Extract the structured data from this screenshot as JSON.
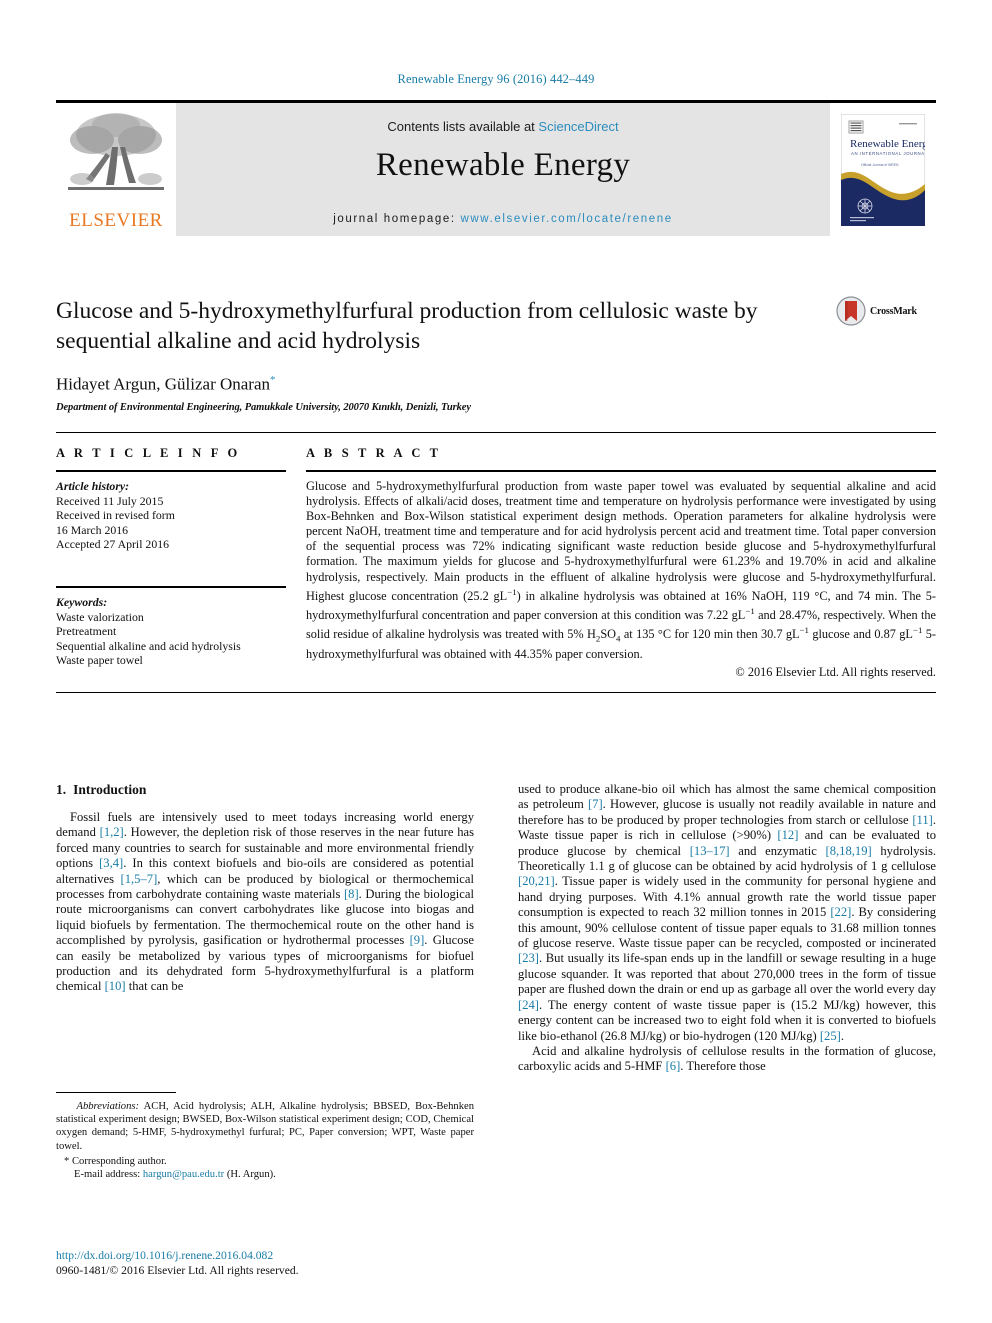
{
  "running_head": "Renewable Energy 96 (2016) 442–449",
  "banner": {
    "publisher_name": "ELSEVIER",
    "contents_prefix": "Contents lists available at ",
    "contents_link": "ScienceDirect",
    "journal_title": "Renewable Energy",
    "homepage_prefix": "journal homepage: ",
    "homepage_url": "www.elsevier.com/locate/renene",
    "cover_title": "Renewable Energy",
    "cover_subtitle": "AN INTERNATIONAL JOURNAL",
    "cover_line3": "Official Journal of WREN – Werner Heilingbrunner"
  },
  "article": {
    "title": "Glucose and 5-hydroxymethylfurfural production from cellulosic waste by sequential alkaline and acid hydrolysis",
    "authors": "Hidayet Argun, Gülizar Onaran",
    "author_marker": "*",
    "affiliation": "Department of Environmental Engineering, Pamukkale University, 20070 Kınıklı, Denizli, Turkey",
    "crossmark_label": "CrossMark"
  },
  "info": {
    "heading": "A R T I C L E   I N F O",
    "history_label": "Article history:",
    "history_lines": [
      "Received 11 July 2015",
      "Received in revised form",
      "16 March 2016",
      "Accepted 27 April 2016"
    ],
    "keywords_label": "Keywords:",
    "keywords": [
      "Waste valorization",
      "Pretreatment",
      "Sequential alkaline and acid hydrolysis",
      "Waste paper towel"
    ]
  },
  "abstract": {
    "heading": "A B S T R A C T",
    "text": "Glucose and 5-hydroxymethylfurfural production from waste paper towel was evaluated by sequential alkaline and acid hydrolysis. Effects of alkali/acid doses, treatment time and temperature on hydrolysis performance were investigated by using Box-Behnken and Box-Wilson statistical experiment design methods. Operation parameters for alkaline hydrolysis were percent NaOH, treatment time and temperature and for acid hydrolysis percent acid and treatment time. Total paper conversion of the sequential process was 72% indicating significant waste reduction beside glucose and 5-hydroxymethylfurfural formation. The maximum yields for glucose and 5-hydroxymethylfurfural were 61.23% and 19.70% in acid and alkaline hydrolysis, respectively. Main products in the effluent of alkaline hydrolysis were glucose and 5-hydroxymethylfurfural. Highest glucose concentration (25.2 gL−1) in alkaline hydrolysis was obtained at 16% NaOH, 119 °C, and 74 min. The 5-hydroxymethylfurfural concentration and paper conversion at this condition was 7.22 gL−1 and 28.47%, respectively. When the solid residue of alkaline hydrolysis was treated with 5% H2SO4 at 135 °C for 120 min then 30.7 gL−1 glucose and 0.87 gL−1 5-hydroxymethylfurfural was obtained with 44.35% paper conversion.",
    "copyright": "© 2016 Elsevier Ltd. All rights reserved."
  },
  "body": {
    "section_number": "1.",
    "section_title": "Introduction",
    "left_paragraph": "Fossil fuels are intensively used to meet todays increasing world energy demand [1,2]. However, the depletion risk of those reserves in the near future has forced many countries to search for sustainable and more environmental friendly options [3,4]. In this context biofuels and bio-oils are considered as potential alternatives [1,5–7], which can be produced by biological or thermochemical processes from carbohydrate containing waste materials [8]. During the biological route microorganisms can convert carbohydrates like glucose into biogas and liquid biofuels by fermentation. The thermochemical route on the other hand is accomplished by pyrolysis, gasification or hydrothermal processes [9]. Glucose can easily be metabolized by various types of microorganisms for biofuel production and its dehydrated form 5-hydroxymethylfurfural is a platform chemical [10] that can be",
    "right_paragraph_1": "used to produce alkane-bio oil which has almost the same chemical composition as petroleum [7]. However, glucose is usually not readily available in nature and therefore has to be produced by proper technologies from starch or cellulose [11]. Waste tissue paper is rich in cellulose (>90%) [12] and can be evaluated to produce glucose by chemical [13–17] and enzymatic [8,18,19] hydrolysis. Theoretically 1.1 g of glucose can be obtained by acid hydrolysis of 1 g cellulose [20,21]. Tissue paper is widely used in the community for personal hygiene and hand drying purposes. With 4.1% annual growth rate the world tissue paper consumption is expected to reach 32 million tonnes in 2015 [22]. By considering this amount, 90% cellulose content of tissue paper equals to 31.68 million tonnes of glucose reserve. Waste tissue paper can be recycled, composted or incinerated [23]. But usually its life-span ends up in the landfill or sewage resulting in a huge glucose squander. It was reported that about 270,000 trees in the form of tissue paper are flushed down the drain or end up as garbage all over the world every day [24]. The energy content of waste tissue paper is (15.2 MJ/kg) however, this energy content can be increased two to eight fold when it is converted to biofuels like bio-ethanol (26.8 MJ/kg) or bio-hydrogen (120 MJ/kg) [25].",
    "right_paragraph_2": "Acid and alkaline hydrolysis of cellulose results in the formation of glucose, carboxylic acids and 5-HMF [6]. Therefore those"
  },
  "footnotes": {
    "abbreviations_label": "Abbreviations:",
    "abbreviations_text": "ACH, Acid hydrolysis; ALH, Alkaline hydrolysis; BBSED, Box-Behnken statistical experiment design; BWSED, Box-Wilson statistical experiment design; COD, Chemical oxygen demand; 5-HMF, 5-hydroxymethyl furfural; PC, Paper conversion; WPT, Waste paper towel.",
    "corresponding_marker": "*",
    "corresponding_text": "Corresponding author.",
    "email_label": "E-mail address:",
    "email": "hargun@pau.edu.tr",
    "email_suffix": "(H. Argun)."
  },
  "footer": {
    "doi": "http://dx.doi.org/10.1016/j.renene.2016.04.082",
    "issn_line": "0960-1481/© 2016 Elsevier Ltd. All rights reserved."
  },
  "colors": {
    "link_blue": "#1a7ca6",
    "elsevier_orange": "#E87722",
    "banner_grey": "#e4e4e4",
    "cover_navy": "#1b2a63",
    "cover_gold": "#c8a12c",
    "crossmark_red": "#C63527"
  }
}
